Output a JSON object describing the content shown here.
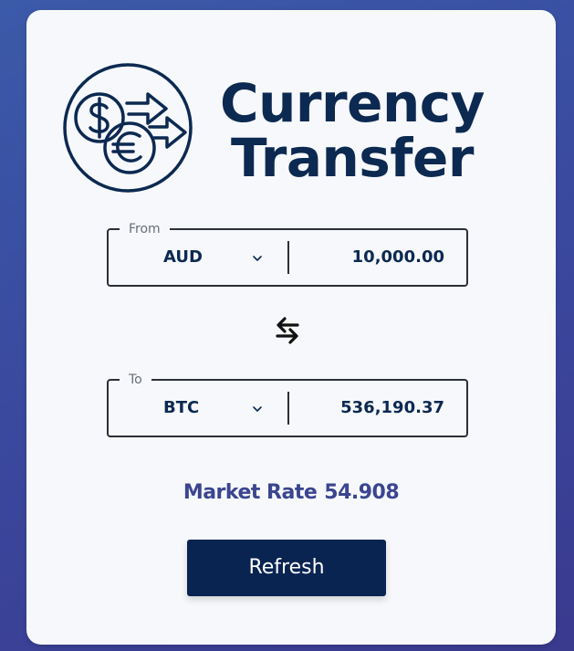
{
  "header": {
    "title_line1": "Currency",
    "title_line2": "Transfer",
    "logo_icon": "currency-exchange-icon"
  },
  "from": {
    "legend": "From",
    "currency": "AUD",
    "amount": "10,000.00"
  },
  "to": {
    "legend": "To",
    "currency": "BTC",
    "amount": "536,190.37"
  },
  "swap_icon": "swap-arrows-icon",
  "market_rate": {
    "label": "Market Rate",
    "value": "54.908"
  },
  "refresh_label": "Refresh",
  "colors": {
    "primary": "#0c2951",
    "button": "#0a2452",
    "rate_text": "#3b4590",
    "card_bg": "#f6f8fb"
  }
}
